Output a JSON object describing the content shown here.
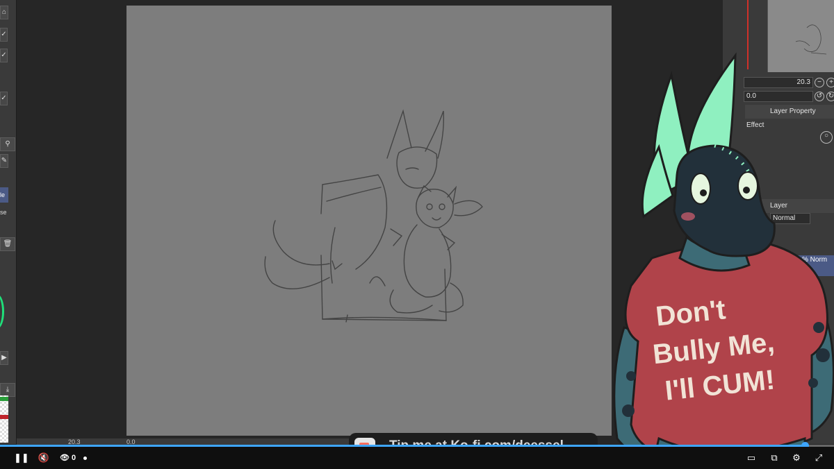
{
  "app": {
    "left_toolbar": {
      "label_1": "le",
      "label_2": "se"
    },
    "right_panel": {
      "brush_size_value": "20.3",
      "opacity_value": "0.0",
      "layer_property_label": "Layer Property",
      "effect_label": "Effect",
      "layer_tab_label": "Layer",
      "blend_mode_value": "Normal",
      "layer_item_text": "% Norm"
    },
    "status_bar": {
      "zoom_value": "20.3",
      "angle_value": "0.0"
    }
  },
  "overlay": {
    "shirt_text": [
      "Don't",
      "Bully Me,",
      "I'll CUM!"
    ],
    "kofi_text": "Tip me at Ko-fi.com/deessel"
  },
  "player": {
    "viewer_count": "0",
    "progress_fraction": 0.965,
    "icons": {
      "pause": "pause-icon",
      "mute": "muted-speaker-icon",
      "viewers": "eye-icon",
      "theater": "theater-mode-icon",
      "miniplayer": "miniplayer-icon",
      "settings": "gear-icon",
      "fullscreen": "fullscreen-icon"
    },
    "accent_color": "#3ea6ff"
  },
  "colors": {
    "canvas": "#7d7d7d",
    "shirt": "#b0434a",
    "fin": "#8ff0c0",
    "kofi_cup": "#ff6f5e"
  }
}
